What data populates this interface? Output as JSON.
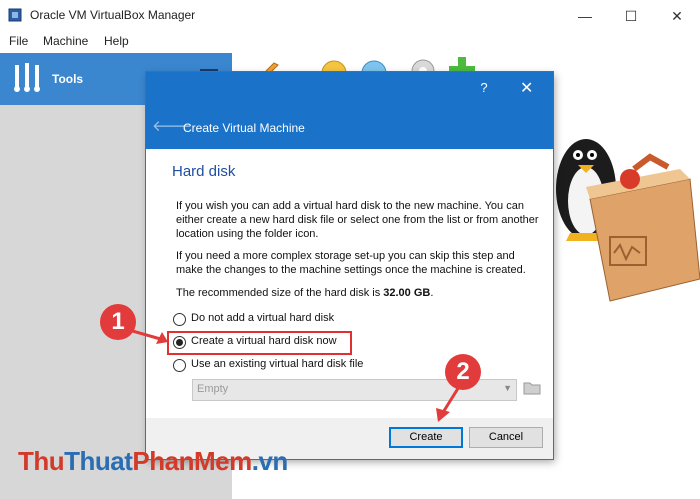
{
  "window": {
    "title": "Oracle VM VirtualBox Manager",
    "minimize": "—",
    "maximize": "☐",
    "close": "✕"
  },
  "menu": {
    "file": "File",
    "machine": "Machine",
    "help": "Help"
  },
  "sidebar": {
    "tools_label": "Tools"
  },
  "dialog": {
    "help": "?",
    "close": "✕",
    "back": "🡐",
    "title": "Create Virtual Machine",
    "section_title": "Hard disk",
    "para1": "If you wish you can add a virtual hard disk to the new machine. You can either create a new hard disk file or select one from the list or from another location using the folder icon.",
    "para2": "If you need a more complex storage set-up you can skip this step and make the changes to the machine settings once the machine is created.",
    "recommended_prefix": "The recommended size of the hard disk is ",
    "recommended_size": "32.00 GB",
    "recommended_suffix": ".",
    "options": [
      {
        "label": "Do not add a virtual hard disk",
        "selected": false
      },
      {
        "label": "Create a virtual hard disk now",
        "selected": true
      },
      {
        "label": "Use an existing virtual hard disk file",
        "selected": false
      }
    ],
    "combo_value": "Empty",
    "create_button": "Create",
    "cancel_button": "Cancel"
  },
  "annotations": {
    "step1": "1",
    "step2": "2"
  },
  "watermark": {
    "part1": "Thu",
    "part2": "Thuat",
    "part3": "PhanMem",
    "part4": ".vn"
  },
  "colors": {
    "accent": "#1a73c9",
    "sidebar_selected": "#3a86cf",
    "annotation": "#e23b3b"
  }
}
